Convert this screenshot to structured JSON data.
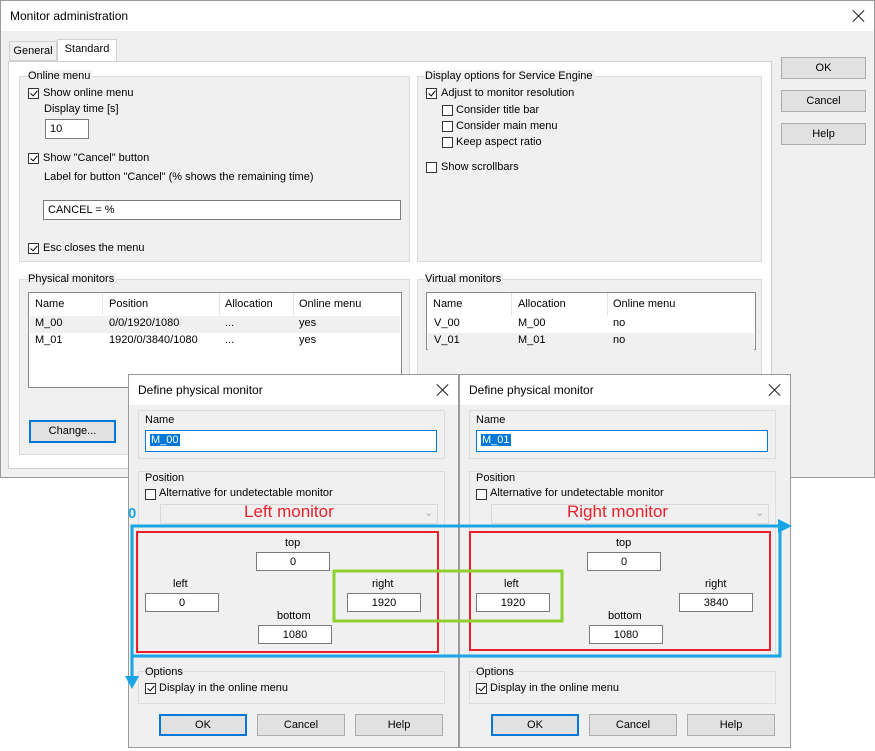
{
  "main": {
    "title": "Monitor administration",
    "tabs": [
      "General",
      "Standard"
    ],
    "buttons": {
      "ok": "OK",
      "cancel": "Cancel",
      "help": "Help"
    },
    "online_menu": {
      "group": "Online menu",
      "show_online_menu": "Show online menu",
      "display_time_label": "Display time [s]",
      "display_time": "10",
      "show_cancel": "Show \"Cancel\" button",
      "cancel_label_caption": "Label for button \"Cancel\" (% shows the remaining time)",
      "cancel_label_value": "CANCEL = %",
      "esc_closes": "Esc closes the menu"
    },
    "display_options": {
      "group": "Display options for Service Engine",
      "adjust": "Adjust to monitor resolution",
      "title_bar": "Consider title bar",
      "main_menu": "Consider main menu",
      "aspect": "Keep aspect ratio",
      "scrollbars": "Show scrollbars"
    },
    "physical": {
      "group": "Physical monitors",
      "columns": [
        "Name",
        "Position",
        "Allocation",
        "Online menu"
      ],
      "rows": [
        [
          "M_00",
          "0/0/1920/1080",
          "...",
          "yes"
        ],
        [
          "M_01",
          "1920/0/3840/1080",
          "...",
          "yes"
        ]
      ],
      "change": "Change..."
    },
    "virtual": {
      "group": "Virtual monitors",
      "columns": [
        "Name",
        "Allocation",
        "Online menu"
      ],
      "rows": [
        [
          "V_00",
          "M_00",
          "no"
        ],
        [
          "V_01",
          "M_01",
          "no"
        ]
      ]
    }
  },
  "dialogs": [
    {
      "title": "Define physical monitor",
      "name_label": "Name",
      "name_value": "M_00",
      "position_label": "Position",
      "alternative": "Alternative for undetectable monitor",
      "top_label": "top",
      "top": "0",
      "left_label": "left",
      "left": "0",
      "right_label": "right",
      "right": "1920",
      "bottom_label": "bottom",
      "bottom": "1080",
      "options_label": "Options",
      "display_in_menu": "Display in the online menu",
      "ok": "OK",
      "cancel": "Cancel",
      "help": "Help"
    },
    {
      "title": "Define physical monitor",
      "name_label": "Name",
      "name_value": "M_01",
      "position_label": "Position",
      "alternative": "Alternative for undetectable monitor",
      "top_label": "top",
      "top": "0",
      "left_label": "left",
      "left": "1920",
      "right_label": "right",
      "right": "3840",
      "bottom_label": "bottom",
      "bottom": "1080",
      "options_label": "Options",
      "display_in_menu": "Display in the online menu",
      "ok": "OK",
      "cancel": "Cancel",
      "help": "Help"
    }
  ],
  "annotations": {
    "left_monitor": "Left monitor",
    "right_monitor": "Right monitor",
    "origin": "0",
    "colors": {
      "red": "#e8212a",
      "blue": "#1aa5e6",
      "green": "#8ed12f"
    }
  }
}
